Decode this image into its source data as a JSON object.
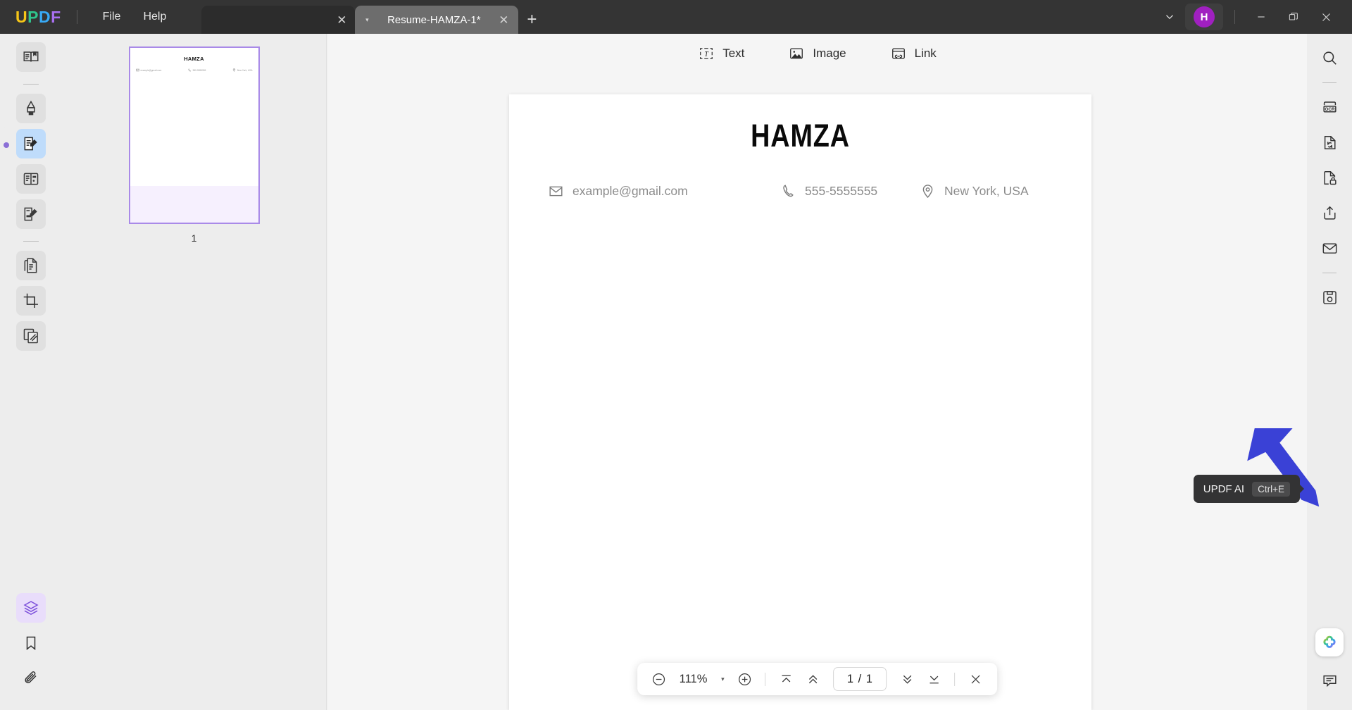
{
  "app": {
    "name": "UPDF",
    "logo_letters": [
      "U",
      "P",
      "D",
      "F"
    ],
    "accent_purple": "#a020c0",
    "titlebar_bg": "#343434",
    "arrow_annotation_color": "#3a41d6"
  },
  "menu": {
    "items": [
      {
        "label": "File",
        "name": "menu-file"
      },
      {
        "label": "Help",
        "name": "menu-help"
      }
    ]
  },
  "tabs": {
    "inactive": {
      "title": "",
      "close_label": "✕"
    },
    "active": {
      "title": "Resume-HAMZA-1*",
      "caret": "▾",
      "close_label": "✕"
    },
    "new_tab_label": "+"
  },
  "window_controls": {
    "chevron": "chevron-down",
    "avatar_letter": "H",
    "minimize": "—",
    "maximize": "restore",
    "close": "✕"
  },
  "left_rail": {
    "items": [
      {
        "name": "reader-mode-icon",
        "label": "Reader"
      },
      {
        "name": "annotate-highlighter-icon",
        "label": "Comment"
      },
      {
        "name": "edit-pdf-icon",
        "label": "Edit PDF",
        "active": true
      },
      {
        "name": "form-fields-icon",
        "label": "Form"
      },
      {
        "name": "sign-document-icon",
        "label": "Sign"
      },
      {
        "name": "organize-pages-icon",
        "label": "Organize Pages"
      },
      {
        "name": "crop-page-icon",
        "label": "Crop"
      },
      {
        "name": "compare-documents-icon",
        "label": "Compare"
      }
    ],
    "bottom_items": [
      {
        "name": "layers-icon",
        "label": "Layers",
        "active": true
      },
      {
        "name": "bookmark-icon",
        "label": "Bookmarks"
      },
      {
        "name": "attachment-icon",
        "label": "Attachments"
      }
    ]
  },
  "thumbnail_panel": {
    "page_number": "1",
    "thumb_title": "HAMZA",
    "thumb_contacts": [
      {
        "icon": "envelope-icon",
        "text": "example@gmail.com"
      },
      {
        "icon": "phone-icon",
        "text": "555-5555555"
      },
      {
        "icon": "location-pin-icon",
        "text": "New York, USA"
      }
    ]
  },
  "content_toolbar": {
    "items": [
      {
        "label": "Text",
        "name": "add-text-tool",
        "icon": "text-box-icon"
      },
      {
        "label": "Image",
        "name": "add-image-tool",
        "icon": "image-icon"
      },
      {
        "label": "Link",
        "name": "add-link-tool",
        "icon": "link-icon"
      }
    ]
  },
  "document": {
    "title": "HAMZA",
    "contacts": [
      {
        "icon": "envelope-icon",
        "text": "example@gmail.com",
        "name": "contact-email"
      },
      {
        "icon": "phone-icon",
        "text": "555-5555555",
        "name": "contact-phone"
      },
      {
        "icon": "location-pin-icon",
        "text": "New York, USA",
        "name": "contact-location"
      }
    ]
  },
  "bottom_toolbar": {
    "zoom_out": "⊖",
    "zoom_level": "111%",
    "zoom_caret": "▾",
    "zoom_in": "⊕",
    "first_page": "first-page",
    "prev_page": "previous-page",
    "page_indicator": "1 / 1",
    "next_page": "next-page",
    "last_page": "last-page",
    "close": "✕"
  },
  "right_rail": {
    "items": [
      {
        "name": "search-icon",
        "label": "Search"
      },
      {
        "name": "ocr-icon",
        "label": "OCR"
      },
      {
        "name": "convert-file-icon",
        "label": "Convert"
      },
      {
        "name": "protect-file-icon",
        "label": "Protect"
      },
      {
        "name": "share-upload-icon",
        "label": "Share"
      },
      {
        "name": "email-envelope-icon",
        "label": "Email"
      },
      {
        "name": "save-floppy-icon",
        "label": "Save"
      }
    ],
    "bottom_items": [
      {
        "name": "updf-ai-icon",
        "label": "UPDF AI"
      },
      {
        "name": "comment-bubble-icon",
        "label": "Comment"
      }
    ]
  },
  "tooltip": {
    "label": "UPDF AI",
    "shortcut": "Ctrl+E"
  }
}
